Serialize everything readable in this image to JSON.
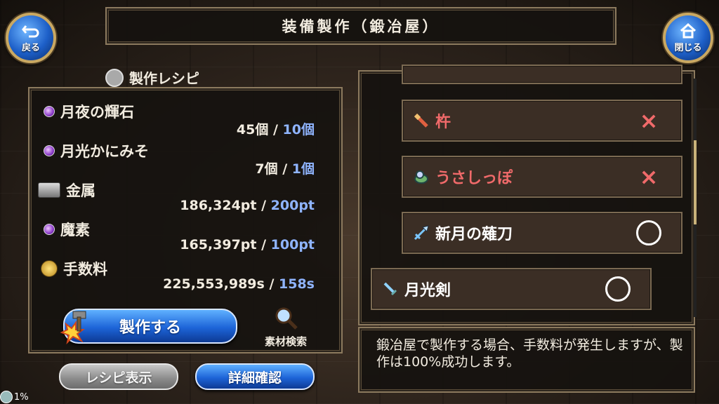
{
  "title": "装備製作（鍛冶屋）",
  "nav": {
    "back_label": "戻る",
    "close_label": "閉じる"
  },
  "recipe": {
    "header": "製作レシピ",
    "materials": [
      {
        "name": "月夜の輝石",
        "have": "45個",
        "sep": " / ",
        "need": "10個",
        "icon": "purple-orb-icon"
      },
      {
        "name": "月光かにみそ",
        "have": "7個",
        "sep": " / ",
        "need": "1個",
        "icon": "purple-orb-icon"
      },
      {
        "name": "金属",
        "have": "186,324pt",
        "sep": " / ",
        "need": "200pt",
        "icon": "metal-ingot-icon"
      },
      {
        "name": "魔素",
        "have": "165,397pt",
        "sep": " / ",
        "need": "100pt",
        "icon": "purple-orb-icon"
      },
      {
        "name": "手数料",
        "have": "225,553,989s",
        "sep": " / ",
        "need": "158s",
        "icon": "coin-icon"
      }
    ],
    "craft_label": "製作する",
    "search_label": "素材検索",
    "recipe_display_label": "レシピ表示",
    "detail_label": "詳細確認"
  },
  "equipment_list": [
    {
      "name": "杵",
      "status": "×",
      "color": "#f06a6a",
      "icon": "pestle-icon"
    },
    {
      "name": "うさしっぽ",
      "status": "×",
      "color": "#f06a6a",
      "icon": "tail-icon"
    },
    {
      "name": "新月の薙刀",
      "status": "○",
      "color": "#ffffff",
      "icon": "naginata-icon"
    },
    {
      "name": "月光剣",
      "status": "○",
      "color": "#ffffff",
      "icon": "sword-icon"
    }
  ],
  "description": "鍛冶屋で製作する場合、手数料が発生しますが、製作は100%成功します。",
  "footer": {
    "percent": "1%"
  },
  "colors": {
    "accent_blue": "#1d64d8",
    "required_value": "#8fb4ff",
    "frame_gold": "#c9a862"
  }
}
